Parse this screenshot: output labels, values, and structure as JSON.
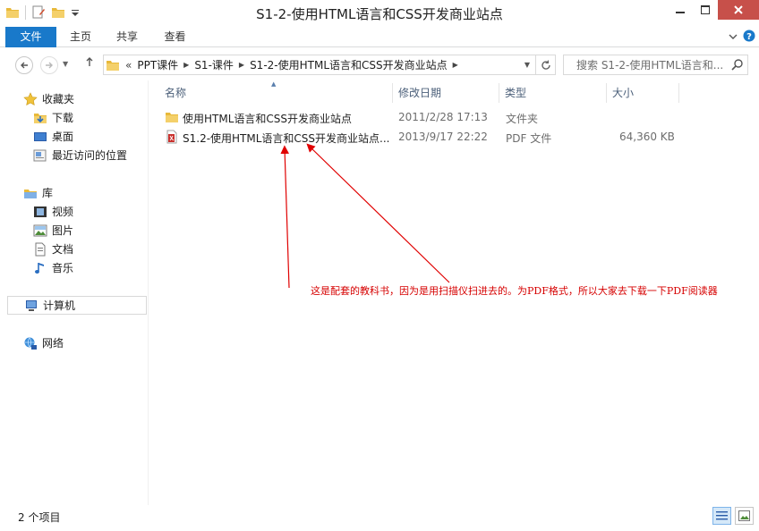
{
  "window": {
    "title": "S1-2-使用HTML语言和CSS开发商业站点"
  },
  "ribbon": {
    "tabs": [
      {
        "label": "文件"
      },
      {
        "label": "主页"
      },
      {
        "label": "共享"
      },
      {
        "label": "查看"
      }
    ]
  },
  "address": {
    "overflow": "«",
    "crumbs": [
      {
        "label": "PPT课件"
      },
      {
        "label": "S1-课件"
      },
      {
        "label": "S1-2-使用HTML语言和CSS开发商业站点"
      }
    ],
    "search_placeholder": "搜索 S1-2-使用HTML语言和..."
  },
  "nav": {
    "favorites": {
      "label": "收藏夹",
      "items": [
        {
          "label": "下载"
        },
        {
          "label": "桌面"
        },
        {
          "label": "最近访问的位置"
        }
      ]
    },
    "libraries": {
      "label": "库",
      "items": [
        {
          "label": "视频"
        },
        {
          "label": "图片"
        },
        {
          "label": "文档"
        },
        {
          "label": "音乐"
        }
      ]
    },
    "computer": {
      "label": "计算机"
    },
    "network": {
      "label": "网络"
    }
  },
  "columns": {
    "name": "名称",
    "date": "修改日期",
    "type": "类型",
    "size": "大小"
  },
  "files": [
    {
      "name": "使用HTML语言和CSS开发商业站点",
      "date": "2011/2/28 17:13",
      "type": "文件夹",
      "size": "",
      "icon": "folder-icon"
    },
    {
      "name": "S1.2-使用HTML语言和CSS开发商业站点...",
      "date": "2013/9/17 22:22",
      "type": "PDF 文件",
      "size": "64,360 KB",
      "icon": "pdf-icon"
    }
  ],
  "annotation": "这是配套的教科书，因为是用扫描仪扫进去的。为PDF格式，所以大家去下载一下PDF阅读器",
  "status": {
    "count": "2 个项目"
  },
  "colors": {
    "file_tab": "#1979ca",
    "close_button": "#c7504a",
    "annotation": "#d60000"
  }
}
